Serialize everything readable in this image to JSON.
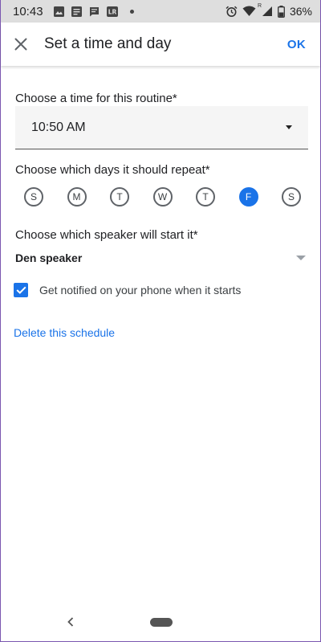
{
  "status_bar": {
    "time": "10:43",
    "battery": "36%",
    "signal_badge": "R",
    "left_icons": [
      "image-icon",
      "news-icon",
      "message-icon",
      "lightroom-icon",
      "dot-icon"
    ],
    "right_icons": [
      "alarm-icon",
      "wifi-icon",
      "cellular-icon",
      "battery-icon"
    ]
  },
  "app_bar": {
    "title": "Set a time and day",
    "ok_label": "OK",
    "close_icon": "close-icon"
  },
  "time_section": {
    "label": "Choose a time for this routine*",
    "value": "10:50 AM"
  },
  "days_section": {
    "label": "Choose which days it should repeat*",
    "days": [
      {
        "letter": "S",
        "selected": false
      },
      {
        "letter": "M",
        "selected": false
      },
      {
        "letter": "T",
        "selected": false
      },
      {
        "letter": "W",
        "selected": false
      },
      {
        "letter": "T",
        "selected": false
      },
      {
        "letter": "F",
        "selected": true
      },
      {
        "letter": "S",
        "selected": false
      }
    ]
  },
  "speaker_section": {
    "label": "Choose which speaker will start it*",
    "value": "Den speaker"
  },
  "notify": {
    "label": "Get notified on your phone when it starts",
    "checked": true
  },
  "delete_label": "Delete this schedule",
  "colors": {
    "accent": "#1a73e8",
    "status_bar_bg": "#dedede"
  }
}
